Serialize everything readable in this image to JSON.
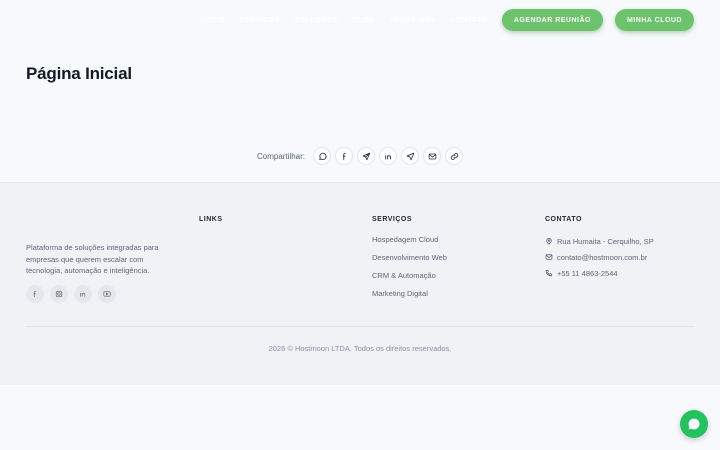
{
  "nav": {
    "links": [
      "Início",
      "Serviços",
      "Soluções",
      "Blog",
      "Sobre Nós",
      "Contato"
    ],
    "schedule_button": "AGENDAR REUNIÃO",
    "cloud_button": "MINHA CLOUD"
  },
  "page": {
    "title": "Página Inicial"
  },
  "share": {
    "label": "Compartilhar:",
    "icons": [
      "whatsapp-icon",
      "facebook-icon",
      "telegram-icon",
      "linkedin-icon",
      "send-icon",
      "email-icon",
      "link-icon"
    ]
  },
  "footer": {
    "about_text": "Plataforma de soluções integradas para empresas que querem escalar com tecnologia, automação e inteligência.",
    "social_icons": [
      "facebook-icon",
      "instagram-icon",
      "linkedin-icon",
      "youtube-icon"
    ],
    "links_title": "LINKS",
    "services_title": "SERVIÇOS",
    "services": [
      "Hospedagem Cloud",
      "Desenvolvimento Web",
      "CRM & Automação",
      "Marketing Digital"
    ],
    "contact_title": "CONTATO",
    "contact": {
      "address": "Rua Humaita - Cerquilho, SP",
      "email": "contato@hostmoon.com.br",
      "phone": "+55 11 4863-2544"
    },
    "copyright": "2026 © Hostmoon LTDA. Todos os direitos reservados."
  },
  "colors": {
    "accent": "#6cc36b",
    "whatsapp": "#22c35e"
  }
}
